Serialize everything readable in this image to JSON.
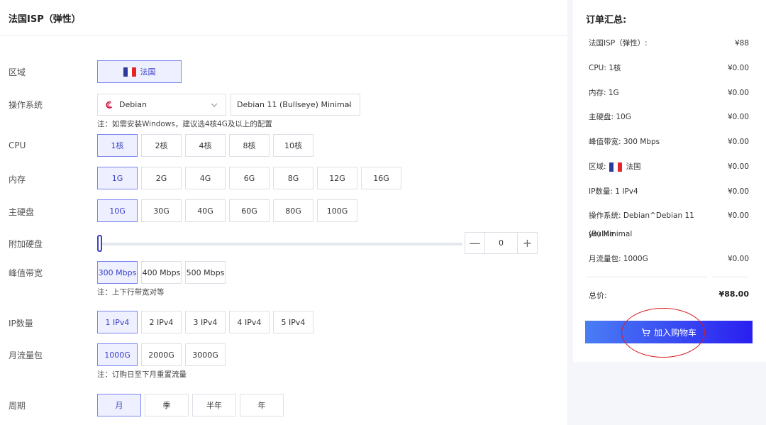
{
  "page": {
    "title": "法国ISP（弹性）"
  },
  "colors": {
    "accent": "#3a3fc4",
    "selected_bg": "#eef0ff",
    "cart_gradient_start": "#4a7df5",
    "cart_gradient_end": "#2a1ff0",
    "annotation": "#d81e1e"
  },
  "config": {
    "region": {
      "label": "区域",
      "option": "法国",
      "flag_colors": [
        "#2b3a9b",
        "#ffffff",
        "#e4262b"
      ]
    },
    "os": {
      "label": "操作系统",
      "distro": "Debian",
      "version": "Debian 11 (Bullseye) Minimal",
      "note": "注：如需安装Windows，建议选4核4G及以上的配置"
    },
    "cpu": {
      "label": "CPU",
      "options": [
        "1核",
        "2核",
        "4核",
        "8核",
        "10核"
      ],
      "selected_index": 0
    },
    "memory": {
      "label": "内存",
      "options": [
        "1G",
        "2G",
        "4G",
        "6G",
        "8G",
        "12G",
        "16G"
      ],
      "selected_index": 0
    },
    "disk": {
      "label": "主硬盘",
      "options": [
        "10G",
        "30G",
        "40G",
        "60G",
        "80G",
        "100G"
      ],
      "selected_index": 0
    },
    "extra_disk": {
      "label": "附加硬盘",
      "value": "0",
      "minus": "—",
      "plus": "+",
      "slider_level": 0
    },
    "bandwidth": {
      "label": "峰值带宽",
      "options": [
        "300 Mbps",
        "400 Mbps",
        "500 Mbps"
      ],
      "selected_index": 0,
      "note": "注：上下行带宽对等"
    },
    "ip_count": {
      "label": "IP数量",
      "options": [
        "1 IPv4",
        "2 IPv4",
        "3 IPv4",
        "4 IPv4",
        "5 IPv4"
      ],
      "selected_index": 0
    },
    "traffic": {
      "label": "月流量包",
      "options": [
        "1000G",
        "2000G",
        "3000G"
      ],
      "selected_index": 0,
      "note": "注：订购日至下月重置流量"
    },
    "period": {
      "label": "周期",
      "options": [
        "月",
        "季",
        "半年",
        "年"
      ],
      "selected_index": 0
    }
  },
  "summary": {
    "title": "订单汇总:",
    "rows": [
      {
        "key": "法国ISP（弹性）:",
        "value": "¥88"
      },
      {
        "key": "CPU: 1核",
        "value": "¥0.00"
      },
      {
        "key": "内存: 1G",
        "value": "¥0.00"
      },
      {
        "key": "主硬盘: 10G",
        "value": "¥0.00"
      },
      {
        "key": "峰值带宽: 300 Mbps",
        "value": "¥0.00"
      },
      {
        "key_prefix": "区域:",
        "key_suffix": "法国",
        "value": "¥0.00"
      },
      {
        "key": "IP数量: 1 IPv4",
        "value": "¥0.00"
      },
      {
        "key_line1": "操作系统: Debian^Debian 11 (Bullse",
        "key_line2": "ye) Minimal",
        "value": "¥0.00"
      },
      {
        "key": "月流量包: 1000G",
        "value": "¥0.00"
      }
    ],
    "total_label": "总价:",
    "total_value": "¥88.00",
    "cart_button": "加入购物车"
  }
}
